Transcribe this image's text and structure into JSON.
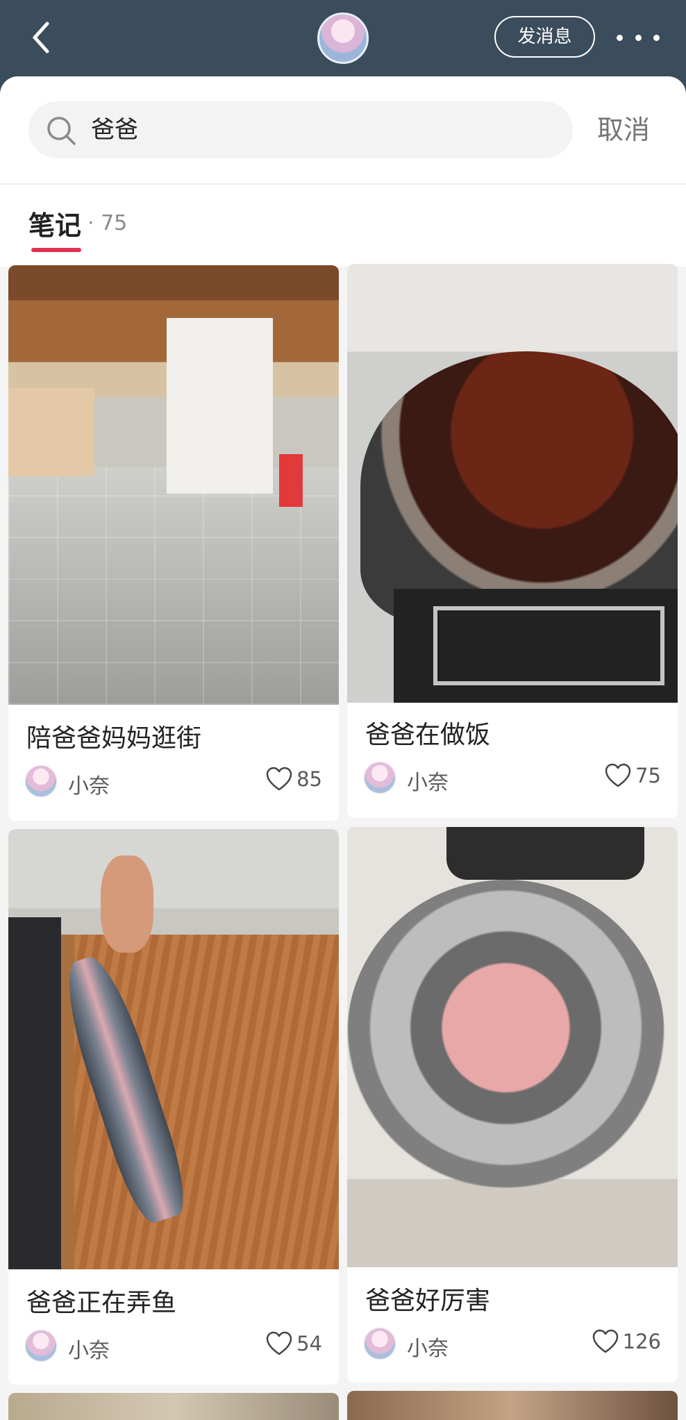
{
  "header": {
    "back_icon": "chevron-left-icon",
    "message_button": "发消息",
    "more_icon": "ellipsis-icon"
  },
  "search": {
    "query": "爸爸",
    "cancel_label": "取消",
    "icon": "search-icon"
  },
  "tabs": {
    "notes_label": "笔记",
    "notes_count": "· 75",
    "active_color": "#e0304e"
  },
  "notes": [
    {
      "title": "陪爸爸妈妈逛街",
      "author": "小奈",
      "likes": "85"
    },
    {
      "title": "爸爸在做饭",
      "author": "小奈",
      "likes": "75"
    },
    {
      "title": "爸爸正在弄鱼",
      "author": "小奈",
      "likes": "54"
    },
    {
      "title": "爸爸好厉害",
      "author": "小奈",
      "likes": "126"
    }
  ]
}
